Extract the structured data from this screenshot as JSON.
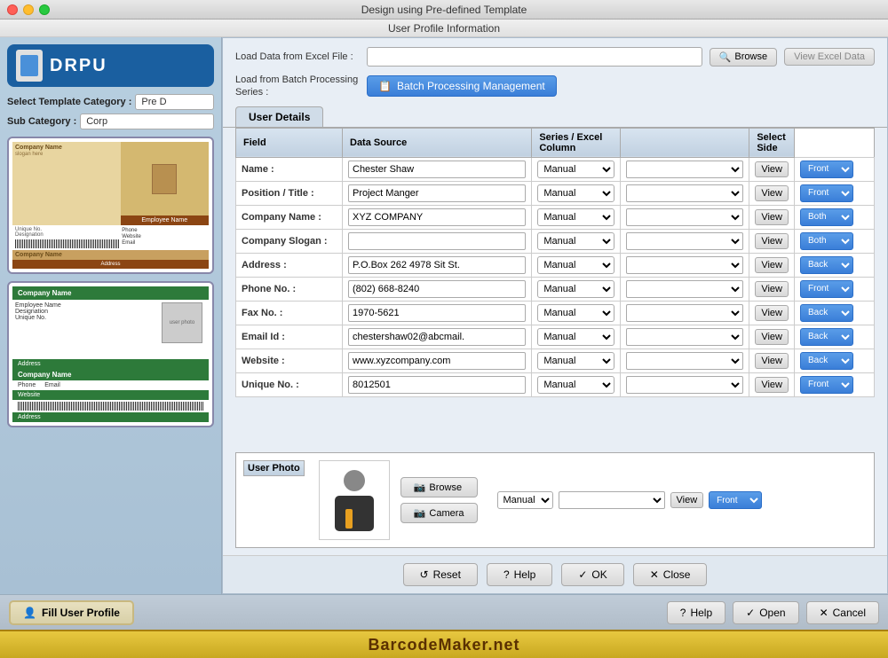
{
  "window": {
    "title": "Design using Pre-defined Template",
    "subtitle": "User Profile Information"
  },
  "sidebar": {
    "logo": "DRPU",
    "template_category_label": "Select Template Category :",
    "template_category_value": "Pre D",
    "sub_category_label": "Sub Category :",
    "sub_category_value": "Corp"
  },
  "load_section": {
    "load_excel_label": "Load Data from Excel File :",
    "load_batch_label": "Load from Batch Processing Series :",
    "browse_btn": "Browse",
    "view_excel_btn": "View Excel Data",
    "batch_btn": "Batch Processing Management"
  },
  "tabs": {
    "active_tab": "User Details"
  },
  "table_headers": {
    "field": "Field",
    "data_source": "Data Source",
    "series_excel": "Series / Excel Column",
    "view": "View",
    "select_side": "Select Side"
  },
  "table_rows": [
    {
      "label": "Name :",
      "value": "Chester Shaw",
      "source": "Manual",
      "series": "",
      "side": "Front"
    },
    {
      "label": "Position / Title :",
      "value": "Project Manger",
      "source": "Manual",
      "series": "",
      "side": "Front"
    },
    {
      "label": "Company Name :",
      "value": "XYZ COMPANY",
      "source": "Manual",
      "series": "",
      "side": "Both"
    },
    {
      "label": "Company Slogan :",
      "value": "",
      "source": "Manual",
      "series": "",
      "side": "Both"
    },
    {
      "label": "Address :",
      "value": "P.O.Box 262 4978 Sit St.",
      "source": "Manual",
      "series": "",
      "side": "Back"
    },
    {
      "label": "Phone No. :",
      "value": "(802) 668-8240",
      "source": "Manual",
      "series": "",
      "side": "Front"
    },
    {
      "label": "Fax No. :",
      "value": "1970-5621",
      "source": "Manual",
      "series": "",
      "side": "Back"
    },
    {
      "label": "Email Id :",
      "value": "chestershaw02@abcmail.",
      "source": "Manual",
      "series": "",
      "side": "Back"
    },
    {
      "label": "Website :",
      "value": "www.xyzcompany.com",
      "source": "Manual",
      "series": "",
      "side": "Back"
    },
    {
      "label": "Unique No. :",
      "value": "8012501",
      "source": "Manual",
      "series": "",
      "side": "Front"
    }
  ],
  "photo_section": {
    "title": "User Photo",
    "browse_btn": "Browse",
    "camera_btn": "Camera",
    "source": "Manual",
    "side": "Front"
  },
  "dialog_buttons": {
    "reset": "Reset",
    "help": "Help",
    "ok": "OK",
    "close": "Close"
  },
  "bottom_bar": {
    "fill_profile": "Fill User Profile",
    "help": "Help",
    "open": "Open",
    "cancel": "Cancel"
  },
  "branding": {
    "text": "BarcodeMaker.net"
  }
}
